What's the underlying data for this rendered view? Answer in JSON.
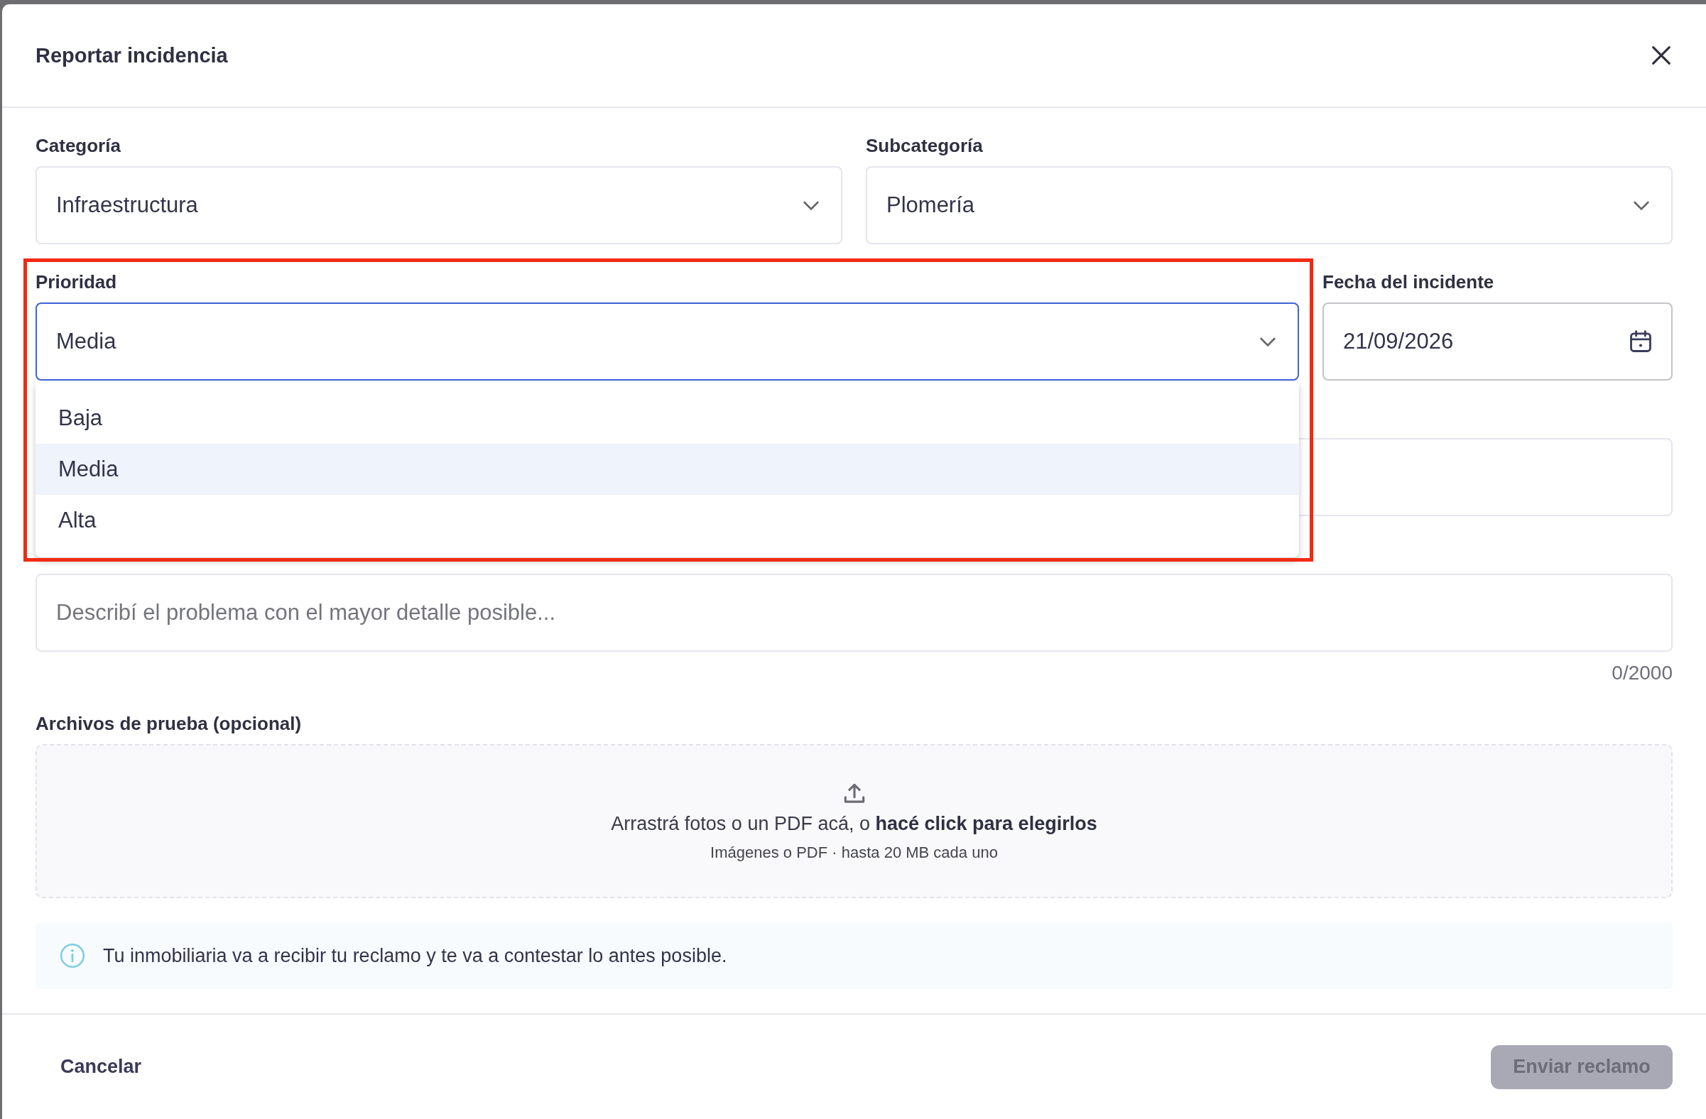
{
  "dialog": {
    "title": "Reportar incidencia"
  },
  "category": {
    "label": "Categoría",
    "value": "Infraestructura"
  },
  "subcategory": {
    "label": "Subcategoría",
    "value": "Plomería"
  },
  "priority": {
    "label": "Prioridad",
    "value": "Media",
    "expanded": true,
    "highlighted": true,
    "options": [
      {
        "label": "Baja",
        "selected": false
      },
      {
        "label": "Media",
        "selected": true
      },
      {
        "label": "Alta",
        "selected": false
      }
    ]
  },
  "incident_date": {
    "label": "Fecha del incidente",
    "value": "21/09/2026"
  },
  "description": {
    "placeholder": "Describí el problema con el mayor detalle posible...",
    "counter": "0/2000"
  },
  "attachments": {
    "label": "Archivos de prueba (opcional)",
    "prompt": "Arrastrá fotos o un PDF acá, o **hacé click para elegirlos**",
    "hint": "Imágenes o PDF · hasta 20 MB cada uno"
  },
  "notice": "Tu inmobiliaria va a recibir tu reclamo y te va a contestar lo antes posible.",
  "actions": {
    "cancel": "Cancelar",
    "submit": {
      "label": "Enviar reclamo",
      "disabled": true
    }
  }
}
